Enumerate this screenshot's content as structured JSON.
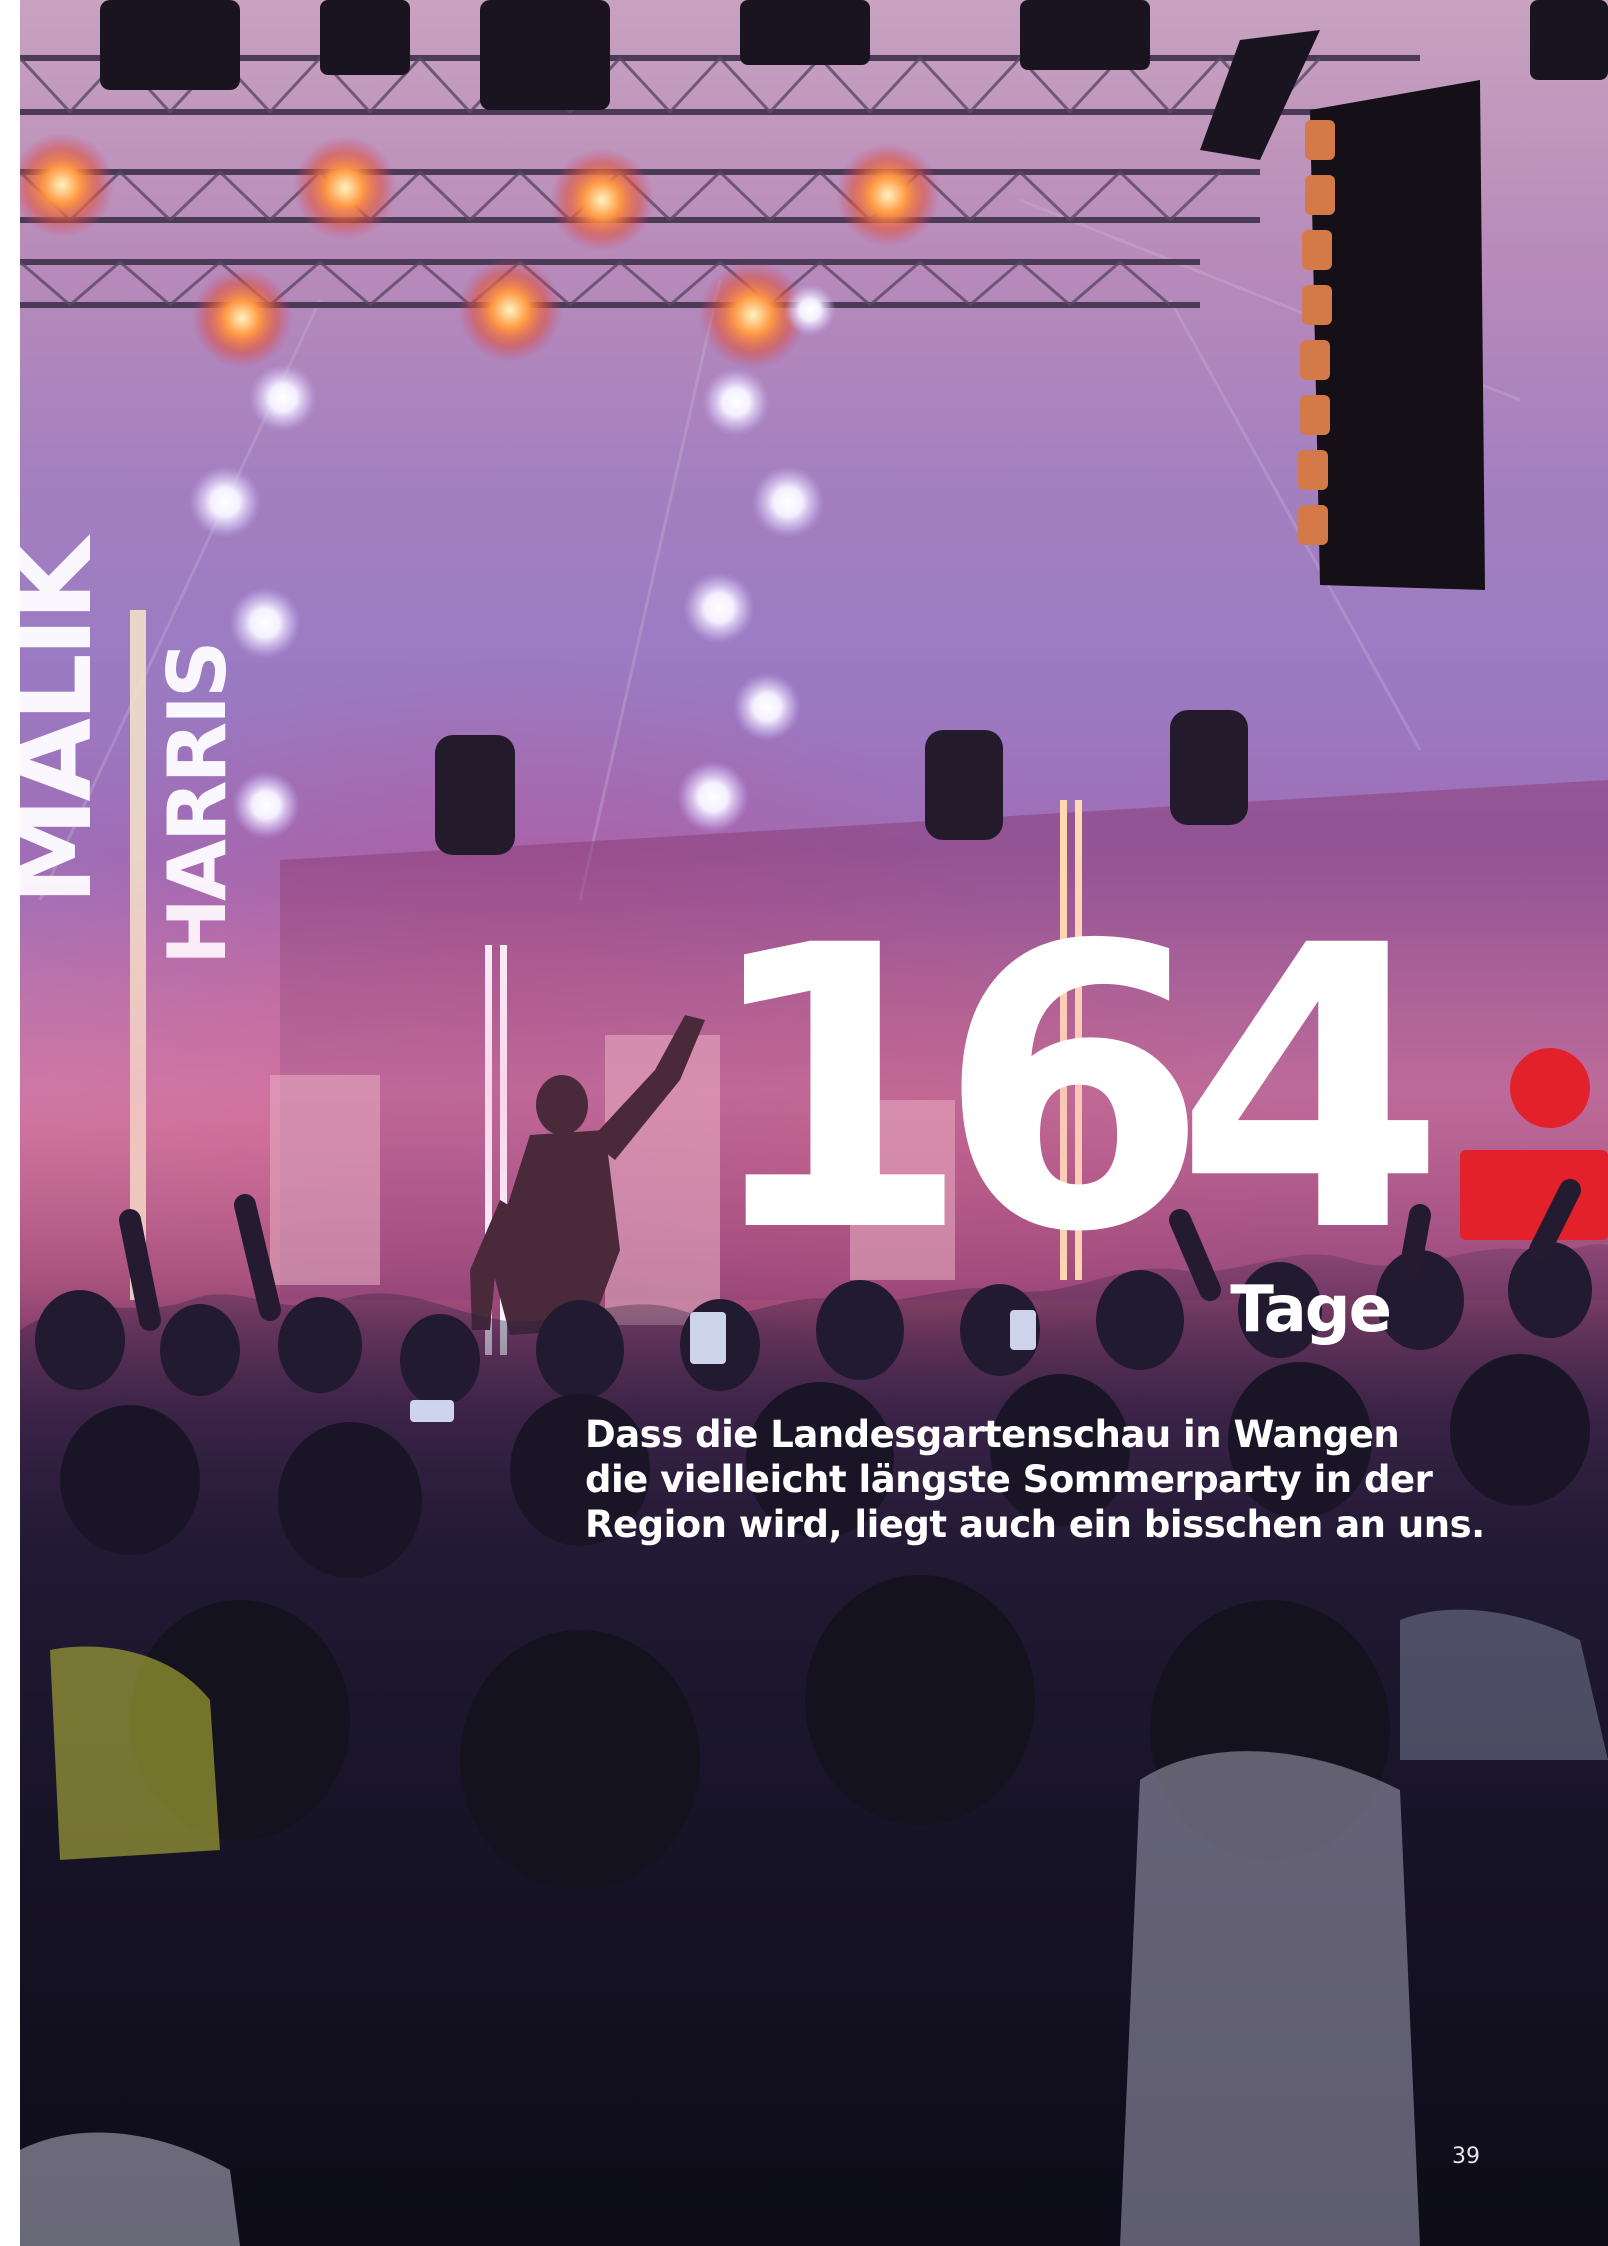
{
  "photo": {
    "description_icon": "concert-photo",
    "stage_sign": [
      "MALIK",
      "HARRIS"
    ],
    "palette": {
      "haze_top": "#c8a2bf",
      "haze_mid": "#a37fc0",
      "stage_glow": "#c06090",
      "crowd_dark": "#151327",
      "lamp_orange": "#ff8a3d",
      "lamp_white": "#f4f0ff",
      "logo_red": "#e3212b"
    }
  },
  "headline": {
    "number": "164",
    "unit": "Tage"
  },
  "claim": {
    "lines": [
      "Dass die Landesgartenschau in Wangen",
      "die vielleicht längste Sommerparty in der",
      "Region wird, liegt auch ein bisschen an uns."
    ]
  },
  "footer": {
    "page_number": "39"
  }
}
